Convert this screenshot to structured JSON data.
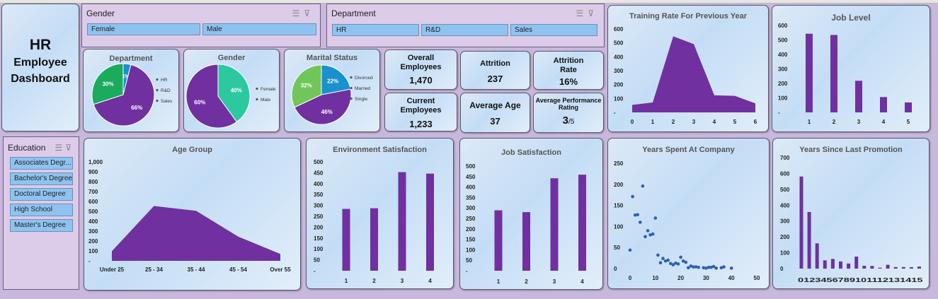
{
  "title": {
    "line1": "HR",
    "line2": "Employee",
    "line3": "Dashboard"
  },
  "slicers": {
    "gender": {
      "title": "Gender",
      "items": [
        "Female",
        "Male"
      ]
    },
    "department": {
      "title": "Department",
      "items": [
        "HR",
        "R&D",
        "Sales"
      ]
    },
    "education": {
      "title": "Education",
      "items": [
        "Associates Degr...",
        "Bachelor's Degree",
        "Doctoral Degree",
        "High School",
        "Master's Degree"
      ]
    }
  },
  "kpis": {
    "overall_employees": {
      "label": "Overall Employees",
      "value": "1,470"
    },
    "attrition": {
      "label": "Attrition",
      "value": "237"
    },
    "attrition_rate": {
      "label": "Attrition Rate",
      "value": "16%"
    },
    "current_employees": {
      "label": "Current Employees",
      "value": "1,233"
    },
    "average_age": {
      "label": "Average Age",
      "value": "37"
    },
    "average_performance": {
      "label": "Average Performance Rating",
      "value_main": "3",
      "value_suffix": "/5"
    }
  },
  "colors": {
    "purple": "#7030a0",
    "green": "#1aab5c",
    "teal": "#2cc9a0",
    "blue": "#1a90d0",
    "light_green": "#70c65a"
  },
  "chart_data": [
    {
      "id": "department",
      "type": "pie",
      "title": "Department",
      "slices": [
        {
          "name": "HR",
          "value": 4,
          "label": "4%",
          "color": "#1a90d0"
        },
        {
          "name": "R&D",
          "value": 66,
          "label": "66%",
          "color": "#7030a0"
        },
        {
          "name": "Sales",
          "value": 30,
          "label": "30%",
          "color": "#1aab5c"
        }
      ],
      "legend": [
        "HR",
        "R&D",
        "Sales"
      ]
    },
    {
      "id": "gender",
      "type": "pie",
      "title": "Gender",
      "slices": [
        {
          "name": "Female",
          "value": 40,
          "label": "40%",
          "color": "#2cc9a0"
        },
        {
          "name": "Male",
          "value": 60,
          "label": "60%",
          "color": "#7030a0"
        }
      ],
      "legend": [
        "Female",
        "Male"
      ]
    },
    {
      "id": "marital",
      "type": "pie",
      "title": "Marital Status",
      "slices": [
        {
          "name": "Divorced",
          "value": 22,
          "label": "22%",
          "color": "#1a90d0"
        },
        {
          "name": "Married",
          "value": 46,
          "label": "46%",
          "color": "#7030a0"
        },
        {
          "name": "Single",
          "value": 32,
          "label": "32%",
          "color": "#70c65a"
        }
      ],
      "legend": [
        "Divorced",
        "Married",
        "Single"
      ]
    },
    {
      "id": "training",
      "type": "area",
      "title": "Training Rate For Previous Year",
      "x": [
        0,
        1,
        2,
        3,
        4,
        5,
        6
      ],
      "values": [
        54,
        71,
        547,
        491,
        123,
        119,
        65
      ],
      "yticks": [
        "-",
        "100",
        "200",
        "300",
        "400",
        "500",
        "600"
      ],
      "ylim": [
        0,
        600
      ]
    },
    {
      "id": "joblevel",
      "type": "bar",
      "title": "Job Level",
      "categories": [
        "1",
        "2",
        "3",
        "4",
        "5"
      ],
      "values": [
        543,
        534,
        218,
        106,
        69
      ],
      "yticks": [
        "-",
        "100",
        "200",
        "300",
        "400",
        "500",
        "600"
      ],
      "ylim": [
        0,
        600
      ]
    },
    {
      "id": "agegroup",
      "type": "area",
      "title": "Age Group",
      "categories": [
        "Under 25",
        "25 - 34",
        "35 - 44",
        "45 - 54",
        "Over 55"
      ],
      "values": [
        97,
        554,
        505,
        245,
        69
      ],
      "yticks": [
        "-",
        "100",
        "200",
        "300",
        "400",
        "500",
        "600",
        "700",
        "800",
        "900",
        "1,000"
      ],
      "ylim": [
        0,
        1000
      ]
    },
    {
      "id": "envsat",
      "type": "bar",
      "title": "Environment Satisfaction",
      "categories": [
        "1",
        "2",
        "3",
        "4"
      ],
      "values": [
        284,
        287,
        453,
        446
      ],
      "yticks": [
        "-",
        "50",
        "100",
        "150",
        "200",
        "250",
        "300",
        "350",
        "400",
        "450",
        "500"
      ],
      "ylim": [
        0,
        500
      ]
    },
    {
      "id": "jobsat",
      "type": "bar",
      "title": "Job Satisfaction",
      "categories": [
        "1",
        "2",
        "3",
        "4"
      ],
      "values": [
        289,
        280,
        442,
        459
      ],
      "yticks": [
        "-",
        "50",
        "100",
        "150",
        "200",
        "250",
        "300",
        "350",
        "400",
        "450",
        "500"
      ],
      "ylim": [
        0,
        500
      ]
    },
    {
      "id": "yearsatco",
      "type": "scatter",
      "title": "Years Spent At Company",
      "points": [
        [
          0,
          44
        ],
        [
          1,
          171
        ],
        [
          2,
          127
        ],
        [
          3,
          128
        ],
        [
          4,
          110
        ],
        [
          5,
          196
        ],
        [
          6,
          76
        ],
        [
          7,
          90
        ],
        [
          8,
          80
        ],
        [
          9,
          82
        ],
        [
          10,
          120
        ],
        [
          11,
          32
        ],
        [
          12,
          14
        ],
        [
          13,
          24
        ],
        [
          14,
          18
        ],
        [
          15,
          20
        ],
        [
          16,
          12
        ],
        [
          17,
          9
        ],
        [
          18,
          13
        ],
        [
          19,
          11
        ],
        [
          20,
          27
        ],
        [
          21,
          18
        ],
        [
          22,
          15
        ],
        [
          23,
          2
        ],
        [
          24,
          6
        ],
        [
          25,
          4
        ],
        [
          26,
          4
        ],
        [
          27,
          3
        ],
        [
          29,
          2
        ],
        [
          30,
          1
        ],
        [
          31,
          3
        ],
        [
          32,
          3
        ],
        [
          33,
          5
        ],
        [
          34,
          1
        ],
        [
          36,
          2
        ],
        [
          37,
          4
        ],
        [
          40,
          1
        ]
      ],
      "xticks": [
        "0",
        "10",
        "20",
        "30",
        "40",
        "50"
      ],
      "xlim": [
        0,
        50
      ],
      "yticks": [
        "0",
        "50",
        "100",
        "150",
        "200",
        "250"
      ],
      "ylim": [
        0,
        250
      ]
    },
    {
      "id": "promotion",
      "type": "bar",
      "title": "Years Since Last Promotion",
      "categories": [
        "0",
        "1",
        "2",
        "3",
        "4",
        "5",
        "6",
        "7",
        "8",
        "9",
        "10",
        "11",
        "12",
        "13",
        "14",
        "15"
      ],
      "values": [
        581,
        357,
        159,
        52,
        61,
        45,
        32,
        76,
        18,
        17,
        6,
        24,
        10,
        10,
        9,
        13
      ],
      "yticks": [
        "0",
        "100",
        "200",
        "300",
        "400",
        "500",
        "600",
        "700"
      ],
      "ylim": [
        0,
        700
      ]
    }
  ]
}
